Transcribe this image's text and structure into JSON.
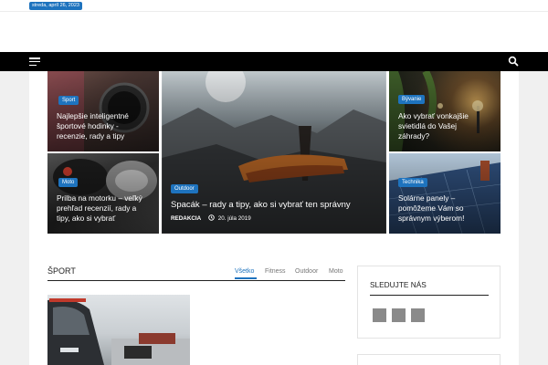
{
  "topbar": {
    "date": "streda, apríl 26, 2023"
  },
  "nav": {
    "menu_icon": "hamburger-icon",
    "search_icon": "search-icon"
  },
  "featured": [
    {
      "category": "Sport",
      "title_lines": [
        "Najlepšie inteligentné",
        "športové hodinky -",
        "recenzie, rady a tipy"
      ]
    },
    {
      "category": "Moto",
      "title_lines": [
        "Prilba na motorku – veľký",
        "prehľad recenzií, rady a",
        "tipy, ako si vybrať"
      ]
    },
    {
      "category": "Outdoor",
      "title": "Spacák – rady a tipy, ako si vybrať ten správny",
      "author": "REDAKCIA",
      "date": "20. júla 2019",
      "clock_icon": "clock-icon"
    },
    {
      "category": "Bývanie",
      "title_lines": [
        "Ako vybrať vonkajšie",
        "svietidlá do Vašej",
        "záhrady?"
      ]
    },
    {
      "category": "Technika",
      "title_lines": [
        "Solárne panely –",
        "pomôžeme Vám so",
        "správnym výberom!"
      ]
    }
  ],
  "section": {
    "title": "ŠPORT",
    "tabs": [
      "Všetko",
      "Fitness",
      "Outdoor",
      "Moto"
    ],
    "active_tab": "Všetko"
  },
  "sidebar": {
    "title": "SLEDUJTE NÁS",
    "social_icons": [
      "facebook-icon",
      "twitter-icon",
      "instagram-icon"
    ]
  },
  "colors": {
    "accent": "#1e73be",
    "nav_bg": "#000000"
  }
}
